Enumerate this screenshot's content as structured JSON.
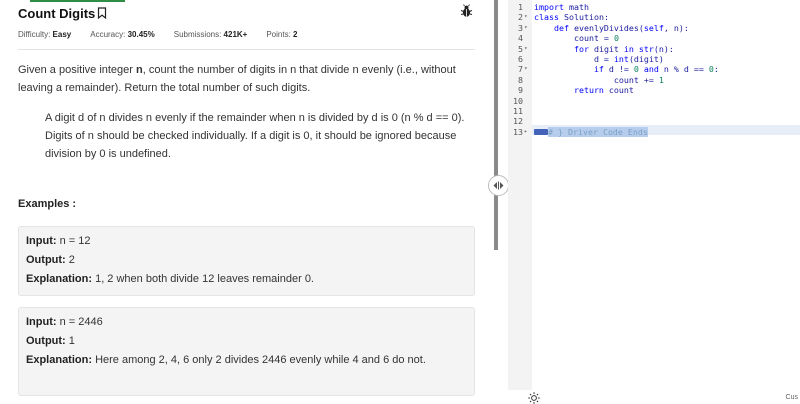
{
  "problem": {
    "title": "Count Digits",
    "difficulty_label": "Difficulty:",
    "difficulty_value": "Easy",
    "accuracy_label": "Accuracy:",
    "accuracy_value": "30.45%",
    "submissions_label": "Submissions:",
    "submissions_value": "421K+",
    "points_label": "Points:",
    "points_value": "2",
    "desc_1": "Given a positive integer ",
    "desc_n": "n",
    "desc_2": ", count the number of digits in n that divide n evenly (i.e., without leaving a remainder). Return the total number of such digits.",
    "bullet_1": "A digit d of n divides n evenly if the remainder when n is divided by d is 0 (n % d == 0).",
    "bullet_2": "Digits of n should be checked individually. If a digit is 0, it should be ignored because division by 0 is undefined.",
    "examples_heading": "Examples :",
    "examples": [
      {
        "input_label": "Input:",
        "input_value": "n = 12",
        "output_label": "Output:",
        "output_value": "2",
        "explanation_label": "Explanation:",
        "explanation_value": "1, 2 when both divide 12 leaves remainder 0."
      },
      {
        "input_label": "Input:",
        "input_value": "n = 2446",
        "output_label": "Output:",
        "output_value": "1",
        "explanation_label": "Explanation:",
        "explanation_value": "Here among 2, 4, 6 only 2 divides 2446 evenly while 4 and 6 do not."
      }
    ]
  },
  "editor": {
    "footer_label": "Cus",
    "lines": [
      {
        "n": "1",
        "fold": ""
      },
      {
        "n": "2",
        "fold": "▾"
      },
      {
        "n": "3",
        "fold": "▾"
      },
      {
        "n": "4",
        "fold": ""
      },
      {
        "n": "5",
        "fold": "▾"
      },
      {
        "n": "6",
        "fold": ""
      },
      {
        "n": "7",
        "fold": "▾"
      },
      {
        "n": "8",
        "fold": ""
      },
      {
        "n": "9",
        "fold": ""
      },
      {
        "n": "10",
        "fold": ""
      },
      {
        "n": "11",
        "fold": ""
      },
      {
        "n": "12",
        "fold": ""
      },
      {
        "n": "13",
        "fold": "▸"
      }
    ],
    "code": {
      "l1a": "import",
      "l1b": " math",
      "l2a": "class",
      "l2b": " Solution:",
      "l3a": "    def",
      "l3b": " evenlyDivides(",
      "l3c": "self",
      "l3d": ", n):",
      "l4a": "        count = ",
      "l4b": "0",
      "l5a": "        for",
      "l5b": " digit ",
      "l5c": "in",
      "l5d": " ",
      "l5e": "str",
      "l5f": "(n):",
      "l6a": "            d = ",
      "l6b": "int",
      "l6c": "(digit)",
      "l7a": "            if",
      "l7b": " d != ",
      "l7c": "0",
      "l7d": " ",
      "l7e": "and",
      "l7f": " n % d == ",
      "l7g": "0",
      "l7h": ":",
      "l8a": "                count += ",
      "l8b": "1",
      "l9a": "        return",
      "l9b": " count",
      "l13": "# } Driver Code Ends"
    }
  }
}
